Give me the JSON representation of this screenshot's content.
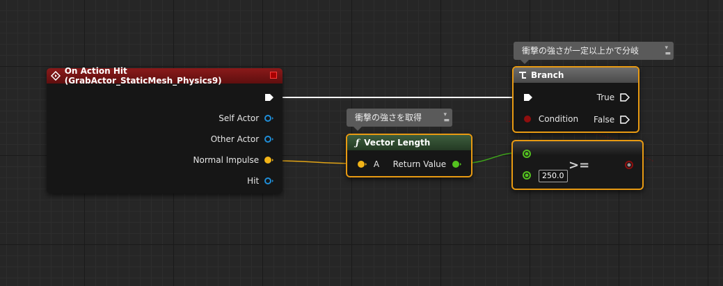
{
  "comments": {
    "branch": "衝撃の強さが一定以上かで分岐",
    "vector": "衝撃の強さを取得"
  },
  "event_node": {
    "title": "On Action Hit (GrabActor_StaticMesh_Physics9)",
    "pins": [
      "Self Actor",
      "Other Actor",
      "Normal Impulse",
      "Hit"
    ]
  },
  "branch_node": {
    "title": "Branch",
    "condition": "Condition",
    "true_label": "True",
    "false_label": "False"
  },
  "vector_node": {
    "title": "Vector Length",
    "input": "A",
    "output": "Return Value"
  },
  "compare_node": {
    "operator": ">=",
    "value": "250.0"
  },
  "colors": {
    "event_header": "#7a1515",
    "branch_header": "#5a5a5a",
    "function_header": "#2e4a2e",
    "selection": "#e89a12",
    "exec_wire": "#ffffff",
    "struct_pin": "#f2b418",
    "float_pin": "#54c21f",
    "object_pin": "#1f8ed8",
    "bool_pin": "#8f0e0e"
  }
}
